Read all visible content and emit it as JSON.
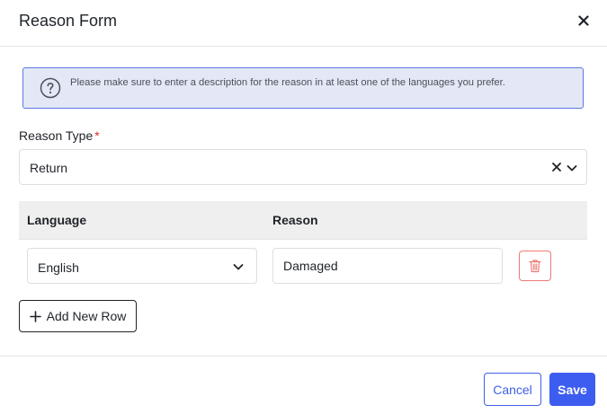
{
  "dialog": {
    "title": "Reason Form"
  },
  "info": {
    "message": "Please make sure to enter a description for the reason in at least one of the languages you prefer."
  },
  "reason_type": {
    "label": "Reason Type",
    "required_mark": "*",
    "value": "Return"
  },
  "table": {
    "headers": {
      "language": "Language",
      "reason": "Reason"
    },
    "rows": [
      {
        "language": "English",
        "reason": "Damaged"
      }
    ]
  },
  "actions": {
    "add_row_label": "Add New Row",
    "cancel_label": "Cancel",
    "save_label": "Save"
  },
  "icons": {
    "close": "close-icon",
    "help": "question-circle-icon",
    "clear": "clear-icon",
    "chevron": "chevron-down-icon",
    "delete": "trash-icon",
    "add": "plus-icon"
  },
  "colors": {
    "primary": "#3d5df0",
    "info_bg": "#e4e8f6",
    "info_border": "#5b79e2",
    "danger": "#ef7b73",
    "required": "#d93025"
  }
}
